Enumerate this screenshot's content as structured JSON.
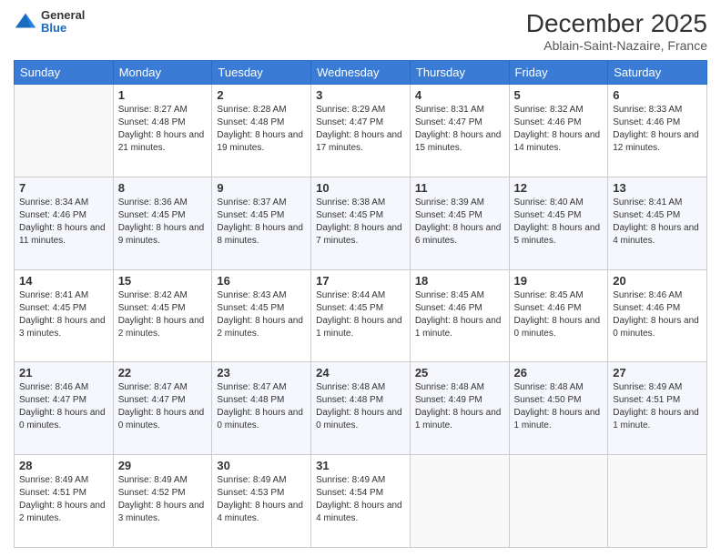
{
  "header": {
    "logo": {
      "general": "General",
      "blue": "Blue"
    },
    "title": "December 2025",
    "location": "Ablain-Saint-Nazaire, France"
  },
  "weekdays": [
    "Sunday",
    "Monday",
    "Tuesday",
    "Wednesday",
    "Thursday",
    "Friday",
    "Saturday"
  ],
  "weeks": [
    [
      {
        "num": "",
        "sunrise": "",
        "sunset": "",
        "daylight": ""
      },
      {
        "num": "1",
        "sunrise": "Sunrise: 8:27 AM",
        "sunset": "Sunset: 4:48 PM",
        "daylight": "Daylight: 8 hours and 21 minutes."
      },
      {
        "num": "2",
        "sunrise": "Sunrise: 8:28 AM",
        "sunset": "Sunset: 4:48 PM",
        "daylight": "Daylight: 8 hours and 19 minutes."
      },
      {
        "num": "3",
        "sunrise": "Sunrise: 8:29 AM",
        "sunset": "Sunset: 4:47 PM",
        "daylight": "Daylight: 8 hours and 17 minutes."
      },
      {
        "num": "4",
        "sunrise": "Sunrise: 8:31 AM",
        "sunset": "Sunset: 4:47 PM",
        "daylight": "Daylight: 8 hours and 15 minutes."
      },
      {
        "num": "5",
        "sunrise": "Sunrise: 8:32 AM",
        "sunset": "Sunset: 4:46 PM",
        "daylight": "Daylight: 8 hours and 14 minutes."
      },
      {
        "num": "6",
        "sunrise": "Sunrise: 8:33 AM",
        "sunset": "Sunset: 4:46 PM",
        "daylight": "Daylight: 8 hours and 12 minutes."
      }
    ],
    [
      {
        "num": "7",
        "sunrise": "Sunrise: 8:34 AM",
        "sunset": "Sunset: 4:46 PM",
        "daylight": "Daylight: 8 hours and 11 minutes."
      },
      {
        "num": "8",
        "sunrise": "Sunrise: 8:36 AM",
        "sunset": "Sunset: 4:45 PM",
        "daylight": "Daylight: 8 hours and 9 minutes."
      },
      {
        "num": "9",
        "sunrise": "Sunrise: 8:37 AM",
        "sunset": "Sunset: 4:45 PM",
        "daylight": "Daylight: 8 hours and 8 minutes."
      },
      {
        "num": "10",
        "sunrise": "Sunrise: 8:38 AM",
        "sunset": "Sunset: 4:45 PM",
        "daylight": "Daylight: 8 hours and 7 minutes."
      },
      {
        "num": "11",
        "sunrise": "Sunrise: 8:39 AM",
        "sunset": "Sunset: 4:45 PM",
        "daylight": "Daylight: 8 hours and 6 minutes."
      },
      {
        "num": "12",
        "sunrise": "Sunrise: 8:40 AM",
        "sunset": "Sunset: 4:45 PM",
        "daylight": "Daylight: 8 hours and 5 minutes."
      },
      {
        "num": "13",
        "sunrise": "Sunrise: 8:41 AM",
        "sunset": "Sunset: 4:45 PM",
        "daylight": "Daylight: 8 hours and 4 minutes."
      }
    ],
    [
      {
        "num": "14",
        "sunrise": "Sunrise: 8:41 AM",
        "sunset": "Sunset: 4:45 PM",
        "daylight": "Daylight: 8 hours and 3 minutes."
      },
      {
        "num": "15",
        "sunrise": "Sunrise: 8:42 AM",
        "sunset": "Sunset: 4:45 PM",
        "daylight": "Daylight: 8 hours and 2 minutes."
      },
      {
        "num": "16",
        "sunrise": "Sunrise: 8:43 AM",
        "sunset": "Sunset: 4:45 PM",
        "daylight": "Daylight: 8 hours and 2 minutes."
      },
      {
        "num": "17",
        "sunrise": "Sunrise: 8:44 AM",
        "sunset": "Sunset: 4:45 PM",
        "daylight": "Daylight: 8 hours and 1 minute."
      },
      {
        "num": "18",
        "sunrise": "Sunrise: 8:45 AM",
        "sunset": "Sunset: 4:46 PM",
        "daylight": "Daylight: 8 hours and 1 minute."
      },
      {
        "num": "19",
        "sunrise": "Sunrise: 8:45 AM",
        "sunset": "Sunset: 4:46 PM",
        "daylight": "Daylight: 8 hours and 0 minutes."
      },
      {
        "num": "20",
        "sunrise": "Sunrise: 8:46 AM",
        "sunset": "Sunset: 4:46 PM",
        "daylight": "Daylight: 8 hours and 0 minutes."
      }
    ],
    [
      {
        "num": "21",
        "sunrise": "Sunrise: 8:46 AM",
        "sunset": "Sunset: 4:47 PM",
        "daylight": "Daylight: 8 hours and 0 minutes."
      },
      {
        "num": "22",
        "sunrise": "Sunrise: 8:47 AM",
        "sunset": "Sunset: 4:47 PM",
        "daylight": "Daylight: 8 hours and 0 minutes."
      },
      {
        "num": "23",
        "sunrise": "Sunrise: 8:47 AM",
        "sunset": "Sunset: 4:48 PM",
        "daylight": "Daylight: 8 hours and 0 minutes."
      },
      {
        "num": "24",
        "sunrise": "Sunrise: 8:48 AM",
        "sunset": "Sunset: 4:48 PM",
        "daylight": "Daylight: 8 hours and 0 minutes."
      },
      {
        "num": "25",
        "sunrise": "Sunrise: 8:48 AM",
        "sunset": "Sunset: 4:49 PM",
        "daylight": "Daylight: 8 hours and 1 minute."
      },
      {
        "num": "26",
        "sunrise": "Sunrise: 8:48 AM",
        "sunset": "Sunset: 4:50 PM",
        "daylight": "Daylight: 8 hours and 1 minute."
      },
      {
        "num": "27",
        "sunrise": "Sunrise: 8:49 AM",
        "sunset": "Sunset: 4:51 PM",
        "daylight": "Daylight: 8 hours and 1 minute."
      }
    ],
    [
      {
        "num": "28",
        "sunrise": "Sunrise: 8:49 AM",
        "sunset": "Sunset: 4:51 PM",
        "daylight": "Daylight: 8 hours and 2 minutes."
      },
      {
        "num": "29",
        "sunrise": "Sunrise: 8:49 AM",
        "sunset": "Sunset: 4:52 PM",
        "daylight": "Daylight: 8 hours and 3 minutes."
      },
      {
        "num": "30",
        "sunrise": "Sunrise: 8:49 AM",
        "sunset": "Sunset: 4:53 PM",
        "daylight": "Daylight: 8 hours and 4 minutes."
      },
      {
        "num": "31",
        "sunrise": "Sunrise: 8:49 AM",
        "sunset": "Sunset: 4:54 PM",
        "daylight": "Daylight: 8 hours and 4 minutes."
      },
      {
        "num": "",
        "sunrise": "",
        "sunset": "",
        "daylight": ""
      },
      {
        "num": "",
        "sunrise": "",
        "sunset": "",
        "daylight": ""
      },
      {
        "num": "",
        "sunrise": "",
        "sunset": "",
        "daylight": ""
      }
    ]
  ]
}
